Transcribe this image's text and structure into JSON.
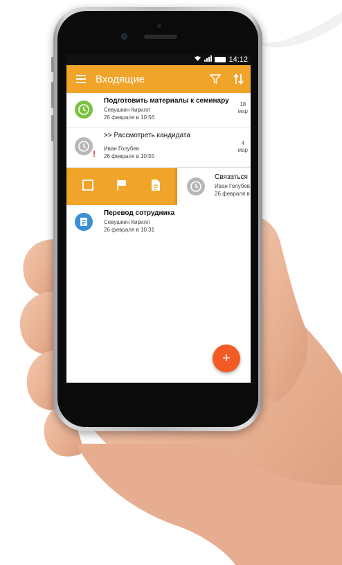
{
  "status_bar": {
    "time": "14:12"
  },
  "app_bar": {
    "title": "Входящие"
  },
  "inbox": {
    "items": [
      {
        "title": "Подготовить материалы к семинару",
        "author": "Севушкин Кирилл",
        "date": "26 февраля в 10:56",
        "due_day": "18",
        "due_month": "мар",
        "status": "green-clock"
      },
      {
        "title": ">> Рассмотреть кандидата",
        "author": "Иван Голубев",
        "date": "26 февраля в 10:55",
        "due_day": "4",
        "due_month": "мар",
        "status": "gray-clock",
        "important": "!"
      },
      {
        "title": "Связаться",
        "author": "Иван Голубев",
        "date": "26 февраля в",
        "status": "gray-clock",
        "swiped": true
      },
      {
        "title": "Перевод сотрудника",
        "author": "Севушкин Кирилл",
        "date": "26 февраля в 10:31",
        "status": "blue-document"
      }
    ]
  },
  "swipe_actions": [
    "checkbox-icon",
    "flag-icon",
    "note-icon"
  ],
  "fab": {
    "label": "+"
  },
  "colors": {
    "accent": "#f0a42a",
    "fab": "#f25b25",
    "green": "#7cc242",
    "blue": "#3c8fd6",
    "gray": "#b7b7b7",
    "danger": "#d0312d"
  }
}
